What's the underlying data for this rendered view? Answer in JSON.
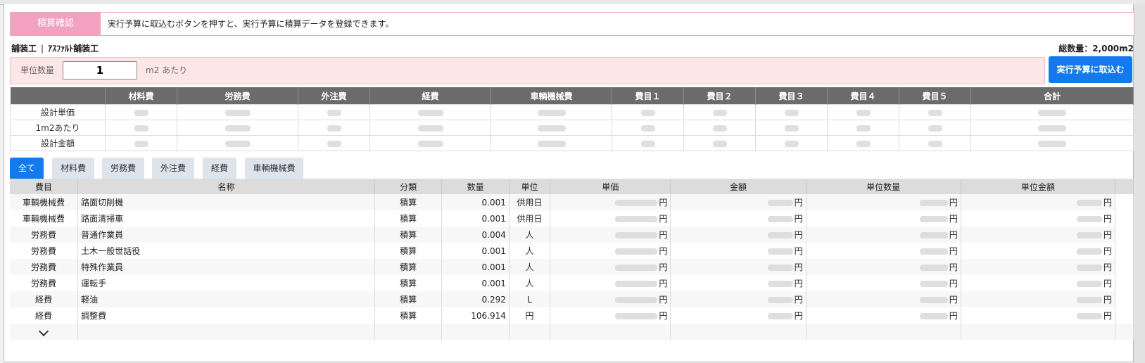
{
  "banner": {
    "label": "積算確認",
    "message": "実行予算に取込むボタンを押すと、実行予算に積算データを登録できます。"
  },
  "breadcrumb": {
    "category": "舗装工",
    "separator": "|",
    "item": "ｱｽﾌｧﾙﾄ舗装工"
  },
  "total_quantity": "総数量：2,000m2",
  "unit": {
    "label": "単位数量",
    "value": "1",
    "suffix": "m2 あたり"
  },
  "exec_button": "実行予算に取込む",
  "summary": {
    "headers": [
      "",
      "材料費",
      "労務費",
      "外注費",
      "経費",
      "車輌機械費",
      "費目１",
      "費目２",
      "費目３",
      "費目４",
      "費目５",
      "合計"
    ],
    "rows": [
      {
        "label": "設計単価"
      },
      {
        "label": "1m2あたり"
      },
      {
        "label": "設計金額"
      }
    ]
  },
  "tabs": [
    {
      "label": "全て",
      "active": true
    },
    {
      "label": "材料費",
      "active": false
    },
    {
      "label": "労務費",
      "active": false
    },
    {
      "label": "外注費",
      "active": false
    },
    {
      "label": "経費",
      "active": false
    },
    {
      "label": "車輌機械費",
      "active": false
    }
  ],
  "detail": {
    "headers": [
      "費目",
      "名称",
      "分類",
      "数量",
      "単位",
      "単価",
      "金額",
      "単位数量",
      "単位金額"
    ],
    "currency": "円",
    "rows": [
      {
        "category": "車輌機械費",
        "name": "路面切削機",
        "class": "積算",
        "qty": "0.001",
        "unit": "供用日"
      },
      {
        "category": "車輌機械費",
        "name": "路面清掃車",
        "class": "積算",
        "qty": "0.001",
        "unit": "供用日"
      },
      {
        "category": "労務費",
        "name": "普通作業員",
        "class": "積算",
        "qty": "0.004",
        "unit": "人"
      },
      {
        "category": "労務費",
        "name": "土木一般世話役",
        "class": "積算",
        "qty": "0.001",
        "unit": "人"
      },
      {
        "category": "労務費",
        "name": "特殊作業員",
        "class": "積算",
        "qty": "0.001",
        "unit": "人"
      },
      {
        "category": "労務費",
        "name": "運転手",
        "class": "積算",
        "qty": "0.001",
        "unit": "人"
      },
      {
        "category": "経費",
        "name": "軽油",
        "class": "積算",
        "qty": "0.292",
        "unit": "L"
      },
      {
        "category": "経費",
        "name": "調整費",
        "class": "積算",
        "qty": "106.914",
        "unit": "円"
      }
    ]
  },
  "icons": {
    "expand": "chevron-down-icon"
  }
}
